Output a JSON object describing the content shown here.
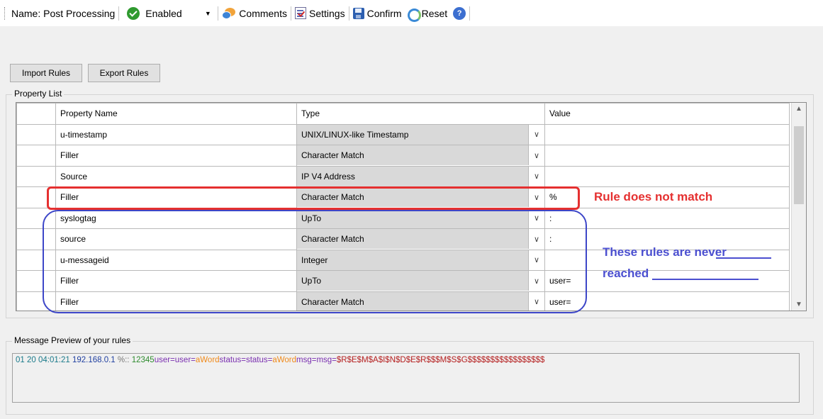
{
  "toolbar": {
    "name_label": "Name: Post Processing",
    "enabled_label": "Enabled",
    "comments_label": "Comments",
    "settings_label": "Settings",
    "confirm_label": "Confirm",
    "reset_label": "Reset",
    "icons": [
      "enabled-check-icon",
      "comments-icon",
      "settings-icon",
      "save-disk-icon",
      "reset-refresh-icon",
      "help-icon"
    ]
  },
  "buttons": {
    "import": "Import Rules",
    "export": "Export Rules"
  },
  "property_list": {
    "title": "Property List",
    "columns": [
      "Property Name",
      "Type",
      "Value"
    ],
    "rows": [
      {
        "name": "u-timestamp",
        "type": "UNIX/LINUX-like Timestamp",
        "value": ""
      },
      {
        "name": "Filler",
        "type": "Character Match",
        "value": ""
      },
      {
        "name": "Source",
        "type": "IP V4 Address",
        "value": ""
      },
      {
        "name": "Filler",
        "type": "Character Match",
        "value": "%"
      },
      {
        "name": "syslogtag",
        "type": "UpTo",
        "value": ":"
      },
      {
        "name": "source",
        "type": "Character Match",
        "value": ":"
      },
      {
        "name": "u-messageid",
        "type": "Integer",
        "value": ""
      },
      {
        "name": "Filler",
        "type": "UpTo",
        "value": "user="
      },
      {
        "name": "Filler",
        "type": "Character Match",
        "value": "user="
      }
    ]
  },
  "annotations": {
    "red": "Rule does not match",
    "blue_line1": "These rules are never",
    "blue_line2": "reached",
    "red_color": "#e53030",
    "blue_color": "#4b4fd0"
  },
  "preview": {
    "title": "Message Preview of your rules",
    "segments": [
      {
        "text": "01 20 04:01:21 ",
        "color": "#1a7a8a"
      },
      {
        "text": "192.168.0.1 ",
        "color": "#1f3fa0"
      },
      {
        "text": "%:: ",
        "color": "#777777"
      },
      {
        "text": "12345",
        "color": "#2e8b2e"
      },
      {
        "text": "user=user=",
        "color": "#7a2fb0"
      },
      {
        "text": "aWord",
        "color": "#f08a1a"
      },
      {
        "text": "status=status=",
        "color": "#7a2fb0"
      },
      {
        "text": "aWord",
        "color": "#f08a1a"
      },
      {
        "text": "msg=msg=",
        "color": "#7a2fb0"
      },
      {
        "text": "$R$E$M$A$I$N$D$E$R$$$M$S$G$$$$$$$$$$$$$$$$$",
        "color": "#b52020"
      }
    ]
  }
}
